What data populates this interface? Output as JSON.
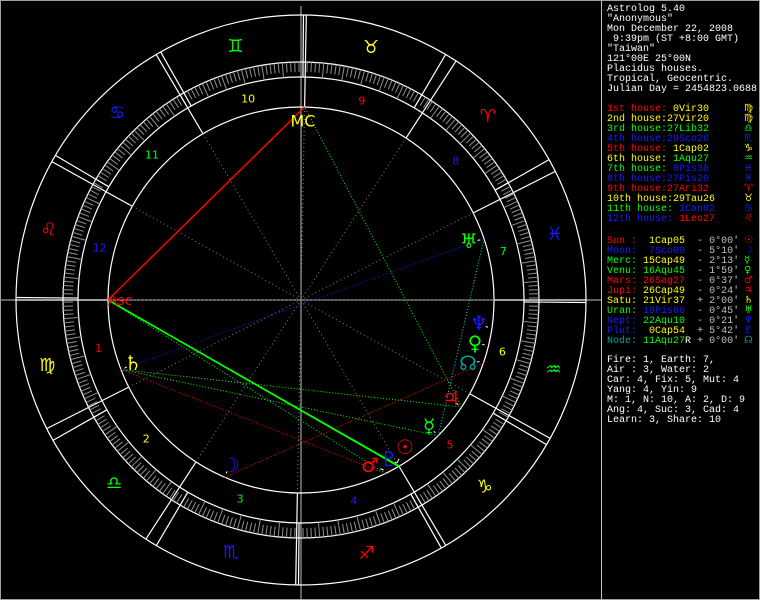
{
  "header": {
    "app": "Astrolog 5.40",
    "name": "\"Anonymous\"",
    "date": "Mon December 22, 2008",
    "time": " 9:39pm (ST +8:00 GMT)",
    "place": "\"Taiwan\"",
    "coords": "121°00E 25°00N",
    "houses_system": "Placidus houses.",
    "zodiac": "Tropical, Geocentric.",
    "julian": "Julian Day = 2454823.0688"
  },
  "colors": {
    "fire": "#ff0000",
    "earth": "#ffff00",
    "air": "#00ff00",
    "water": "#1a1aff",
    "node": "#00a0a0",
    "orb": "#c0c0c0"
  },
  "houses": [
    {
      "label": "1st house:",
      "value": " 0Vir30",
      "glyph": "♍",
      "lc": "fire",
      "vc": "earth"
    },
    {
      "label": "2nd house:",
      "value": "27Vir20",
      "glyph": "♍",
      "lc": "earth",
      "vc": "earth"
    },
    {
      "label": "3rd house:",
      "value": "27Lib32",
      "glyph": "♎",
      "lc": "air",
      "vc": "air"
    },
    {
      "label": "4th house:",
      "value": "29Sco26",
      "glyph": "♏",
      "lc": "water",
      "vc": "water"
    },
    {
      "label": "5th house:",
      "value": " 1Cap02",
      "glyph": "♑",
      "lc": "fire",
      "vc": "earth"
    },
    {
      "label": "6th house:",
      "value": " 1Aqu27",
      "glyph": "♒",
      "lc": "earth",
      "vc": "air"
    },
    {
      "label": "7th house:",
      "value": " 0Pis30",
      "glyph": "♓",
      "lc": "air",
      "vc": "water"
    },
    {
      "label": "8th house:",
      "value": "27Pis20",
      "glyph": "♓",
      "lc": "water",
      "vc": "water"
    },
    {
      "label": "9th house:",
      "value": "27Ari32",
      "glyph": "♈",
      "lc": "fire",
      "vc": "fire"
    },
    {
      "label": "10th house:",
      "value": "29Tau26",
      "glyph": "♉",
      "lc": "earth",
      "vc": "earth"
    },
    {
      "label": "11th house:",
      "value": " 1Can02",
      "glyph": "♋",
      "lc": "air",
      "vc": "water"
    },
    {
      "label": "12th house:",
      "value": " 1Leo27",
      "glyph": "♌",
      "lc": "water",
      "vc": "fire"
    }
  ],
  "planets": [
    {
      "name": "Sun :",
      "pos": " 1Cap05",
      "retro": " ",
      "orb": "- 0°00'",
      "glyph": "☉",
      "nc": "fire",
      "pc": "earth",
      "lon": 271.08
    },
    {
      "name": "Moon:",
      "pos": " 7Sco09",
      "retro": " ",
      "orb": "- 5°10'",
      "glyph": "☽",
      "nc": "water",
      "pc": "water",
      "lon": 217.15
    },
    {
      "name": "Merc:",
      "pos": "15Cap49",
      "retro": " ",
      "orb": "- 2°13'",
      "glyph": "☿",
      "nc": "air",
      "pc": "earth",
      "lon": 285.82
    },
    {
      "name": "Venu:",
      "pos": "16Aqu45",
      "retro": " ",
      "orb": "- 1°59'",
      "glyph": "♀",
      "nc": "air",
      "pc": "air",
      "lon": 316.75
    },
    {
      "name": "Mars:",
      "pos": "26Sag27",
      "retro": " ",
      "orb": "- 0°37'",
      "glyph": "♂",
      "nc": "fire",
      "pc": "fire",
      "lon": 266.45
    },
    {
      "name": "Jupi:",
      "pos": "26Cap49",
      "retro": " ",
      "orb": "- 0°24'",
      "glyph": "♃",
      "nc": "fire",
      "pc": "earth",
      "lon": 296.82
    },
    {
      "name": "Satu:",
      "pos": "21Vir37",
      "retro": " ",
      "orb": "+ 2°00'",
      "glyph": "♄",
      "nc": "earth",
      "pc": "earth",
      "lon": 171.62
    },
    {
      "name": "Uran:",
      "pos": "19Pis00",
      "retro": " ",
      "orb": "- 0°45'",
      "glyph": "♅",
      "nc": "air",
      "pc": "water",
      "lon": 349.0
    },
    {
      "name": "Nept:",
      "pos": "22Aqu10",
      "retro": " ",
      "orb": "- 0°21'",
      "glyph": "♆",
      "nc": "water",
      "pc": "air",
      "lon": 322.17
    },
    {
      "name": "Plut:",
      "pos": " 0Cap54",
      "retro": " ",
      "orb": "+ 5°42'",
      "glyph": "♇",
      "nc": "water",
      "pc": "earth",
      "lon": 270.9
    },
    {
      "name": "Node:",
      "pos": "11Aqu27",
      "retro": "R",
      "orb": "+ 0°00'",
      "glyph": "☊",
      "nc": "node",
      "pc": "air",
      "lon": 311.45
    }
  ],
  "stats": [
    "Fire: 1, Earth: 7,",
    "Air : 3, Water: 2",
    "Car: 4, Fix: 5, Mut: 4",
    "Yang: 4, Yin: 9",
    "M: 1, N: 10, A: 2, D: 9",
    "Ang: 4, Suc: 3, Cad: 4",
    "Learn: 3, Share: 10"
  ],
  "wheel": {
    "asc_label": "Asc",
    "mc_label": "MC",
    "asc_lon": 150.5,
    "mc_lon": 59.43,
    "cusps": [
      150.5,
      177.33,
      207.53,
      239.43,
      271.03,
      301.45,
      330.5,
      357.33,
      27.53,
      59.43,
      91.03,
      121.45
    ],
    "house_numbers": [
      "1",
      "2",
      "3",
      "4",
      "5",
      "6",
      "7",
      "8",
      "9",
      "10",
      "11",
      "12"
    ],
    "signs": [
      "♈",
      "♉",
      "♊",
      "♋",
      "♌",
      "♍",
      "♎",
      "♏",
      "♐",
      "♑",
      "♒",
      "♓"
    ]
  }
}
